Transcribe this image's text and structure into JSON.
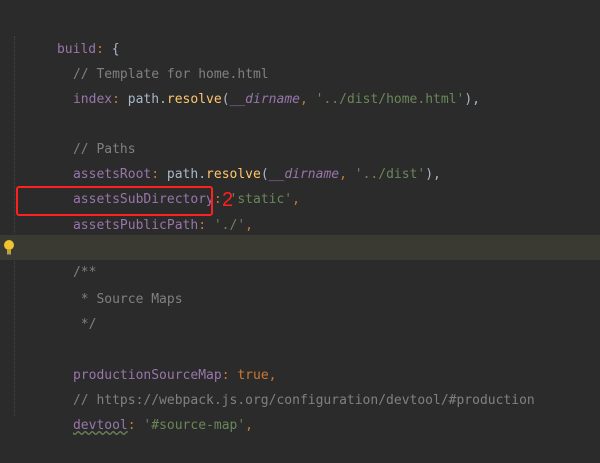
{
  "code": {
    "l1": {
      "key": "build",
      "colon": ": ",
      "brace": "{"
    },
    "l2": {
      "comment": "// Template for home.html"
    },
    "l3": {
      "key": "index",
      "colon": ": ",
      "obj": "path",
      "dot": ".",
      "fn": "resolve",
      "open": "(",
      "dirname": "__dirname",
      "comma": ", ",
      "str": "'../dist/home.html'",
      "close": "),"
    },
    "l5": {
      "comment": "// Paths"
    },
    "l6": {
      "key": "assetsRoot",
      "colon": ": ",
      "obj": "path",
      "dot": ".",
      "fn": "resolve",
      "open": "(",
      "dirname": "__dirname",
      "comma": ", ",
      "str": "'../dist'",
      "close": "),"
    },
    "l7": {
      "key": "assetsSubDirectory",
      "colon": ": ",
      "str": "'static'",
      "comma": ","
    },
    "l8": {
      "key": "assetsPublicPath",
      "colon": ": ",
      "str": "'./'",
      "comma": ","
    },
    "l10": {
      "comment": "/**"
    },
    "l11": {
      "comment": " * Source Maps"
    },
    "l12": {
      "comment": " */"
    },
    "l14": {
      "key": "productionSourceMap",
      "colon": ": ",
      "val": "true",
      "comma": ","
    },
    "l15": {
      "comment": "// https://webpack.js.org/configuration/devtool/#production"
    },
    "l16": {
      "key": "devtool",
      "colon": ": ",
      "str": "'#source-map'",
      "comma": ","
    }
  },
  "annotation": {
    "marker": "2"
  },
  "colors": {
    "highlight": "#ff2020",
    "background": "#2b2b2b"
  },
  "icons": {
    "gutter": "lightbulb-icon"
  }
}
